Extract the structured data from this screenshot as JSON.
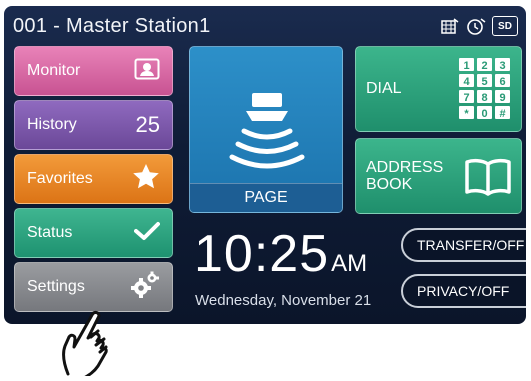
{
  "header": {
    "title": "001 - Master Station1",
    "icons": [
      "calendar-icon",
      "timer-icon",
      "sd-card-icon"
    ],
    "sd_label": "SD"
  },
  "sidebar": {
    "monitor": {
      "label": "Monitor",
      "icon": "monitor-icon"
    },
    "history": {
      "label": "History",
      "count": "25"
    },
    "favorites": {
      "label": "Favorites",
      "icon": "star-icon"
    },
    "status": {
      "label": "Status",
      "icon": "check-icon"
    },
    "settings": {
      "label": "Settings",
      "icon": "gear-icon"
    }
  },
  "main": {
    "page_label": "PAGE",
    "dial_label": "DIAL",
    "keypad": [
      "1",
      "2",
      "3",
      "4",
      "5",
      "6",
      "7",
      "8",
      "9",
      "*",
      "0",
      "#"
    ],
    "address_label": "ADDRESS\nBOOK",
    "time": "10:25",
    "ampm": "AM",
    "date": "Wednesday, November 21",
    "transfer_label": "TRANSFER/OFF",
    "privacy_label": "PRIVACY/OFF"
  },
  "colors": {
    "monitor": "#d96aa7",
    "history": "#7d59ad",
    "favorites": "#e8862a",
    "status": "#2fa47f",
    "settings": "#888a8e",
    "page": "#2583bd",
    "dial": "#2ea27d",
    "background": "#13223f"
  }
}
